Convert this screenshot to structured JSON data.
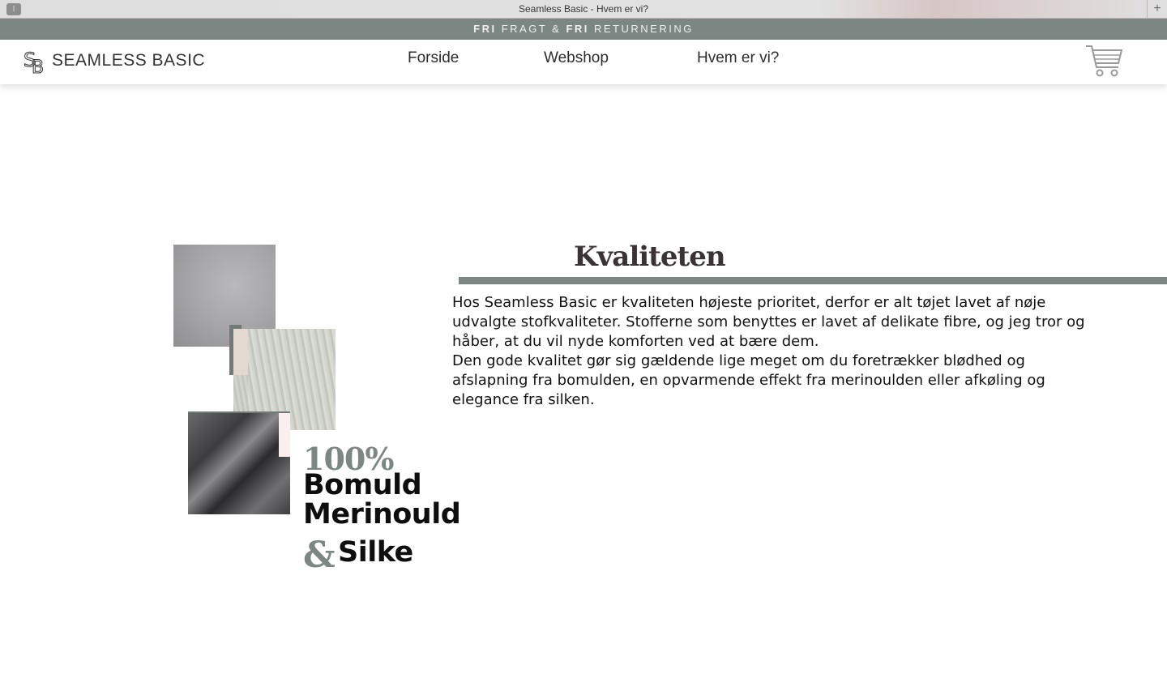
{
  "browser": {
    "window_title": "Seamless Basic - Hvem er vi?",
    "menu_icon": "sidebar-icon",
    "new_tab_icon": "plus-icon"
  },
  "promo": {
    "part1": "FRI",
    "part2": " FRAGT & ",
    "part3": "FRI",
    "part4": " RETURNERING"
  },
  "header": {
    "logo_text": "SEAMLESS BASIC",
    "nav": [
      {
        "label": "Forside"
      },
      {
        "label": "Webshop"
      },
      {
        "label": "Hvem er vi?"
      }
    ],
    "cart_icon": "shopping-cart-icon"
  },
  "content": {
    "percent": "100%",
    "materials": [
      "Bomuld",
      "Merinould",
      "Silke"
    ],
    "ampersand": "&",
    "heading": "Kvaliteten",
    "paragraph1": "Hos Seamless Basic er kvaliteten højeste prioritet, derfor er alt tøjet lavet af nøje udvalgte stofkvaliteter. Stofferne som benyttes er lavet af delikate fibre, og jeg tror og håber, at du vil nyde komforten ved at bære dem.",
    "paragraph2": "Den gode kvalitet gør sig gældende lige meget om du foretrækker blødhed og afslapning fra bomulden, en opvarmende effekt fra merinoulden eller afkøling og elegance fra silken."
  },
  "colors": {
    "accent_gray_green": "#7c8683",
    "heading_color": "#3a3335",
    "text_color": "#111111"
  }
}
